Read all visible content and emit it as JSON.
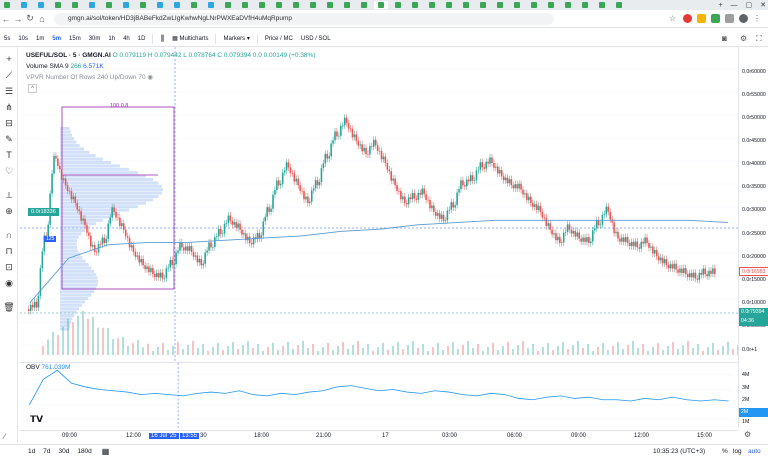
{
  "browser": {
    "url": "gmgn.ai/sol/token/HD3jBABeFkdZwLIgKwhwNgLNrPWXEaDVfH4uMqRpump",
    "tab_colors": [
      "#3aa757",
      "#2ea7e0",
      "#2ea7e0",
      "#3aa757",
      "#3aa757",
      "#2ea7e0",
      "#3aa757",
      "#2ea7e0",
      "#3aa757",
      "#2ea7e0",
      "#2ea7e0",
      "#3aa757",
      "#2ea7e0",
      "#3aa757",
      "#3aa757",
      "#3aa757",
      "#3aa757",
      "#3aa757",
      "#3aa757",
      "#3aa757",
      "#3aa757",
      "#3aa757",
      "#3aa757",
      "#3aa757",
      "#3aa757",
      "#3aa757",
      "#3aa757",
      "#3aa757",
      "#3aa757",
      "#3aa757",
      "#3aa757",
      "#3aa757",
      "#3aa757",
      "#3aa757",
      "#3aa757",
      "#3aa757",
      "#3aa757"
    ],
    "window_controls": [
      "+",
      "—",
      "▢",
      "✕"
    ]
  },
  "toolbar": {
    "intervals": [
      "5s",
      "10s",
      "1m",
      "5m",
      "15m",
      "30m",
      "1h",
      "4h",
      "1D"
    ],
    "active_interval": "5m",
    "multicharts": "Multicharts",
    "markers": "Markers",
    "price_mc": "Price / MC",
    "currency": "USD / SOL"
  },
  "legend": {
    "symbol": "USEFUL/SOL · 5 · GMGN.AI",
    "ohlc": "O 0.079119 H 0.079442 L 0.078764 C 0.079394 0.0 0.00149 (+0.38%)",
    "volume": "Volume SMA 9",
    "volume_val_1": "266",
    "volume_val_2": "6.571K",
    "vpvr": "VPVR Number Of Rows 240 Up/Down 70",
    "obv_label": "OBV",
    "obv_value": "761.039M",
    "box_label": "100 0.8",
    "marker_125": "125",
    "price_label_left": "0.0r18336"
  },
  "price_axis": {
    "ticks": [
      "0.0r60000",
      "0.0r55000",
      "0.0r50000",
      "0.0r45000",
      "0.0r40000",
      "0.0r35000",
      "0.0r30000",
      "0.0r25000",
      "0.0r20000",
      "0.0r15000",
      "0.0r10000",
      "0.0r50000",
      "0.0r+1"
    ],
    "red_label": "0.0r16983",
    "green_label": "0.0r79394",
    "green_countdown": "04:36",
    "obv_ticks": [
      "4M",
      "3M",
      "2M",
      "1M"
    ],
    "obv_label_box": "2M"
  },
  "time_axis": {
    "labels": [
      "09:00",
      "12:00",
      "16 Jul '25",
      "13:55",
      "30",
      "18:00",
      "21:00",
      "17",
      "03:00",
      "06:00",
      "09:00",
      "12:00",
      "15:00"
    ]
  },
  "bottom": {
    "ranges": [
      "1d",
      "7d",
      "30d",
      "180d"
    ],
    "clock": "10:35:23 (UTC+3)",
    "pct": "%",
    "log": "log",
    "auto": "auto"
  },
  "colors": {
    "up": "#26a69a",
    "down": "#ef5350",
    "accent": "#2962ff",
    "ma_line": "#5b9bd5",
    "box": "#9c27b0",
    "volume_profile": "#9bbcf2"
  },
  "chart_data": {
    "type": "candlestick",
    "series": [
      {
        "name": "USEFUL/SOL",
        "values": [
          0.095,
          0.25,
          0.43,
          0.37,
          0.33,
          0.28,
          0.22,
          0.24,
          0.31,
          0.27,
          0.22,
          0.19,
          0.17,
          0.16,
          0.19,
          0.23,
          0.22,
          0.19,
          0.23,
          0.26,
          0.29,
          0.27,
          0.24,
          0.25,
          0.31,
          0.37,
          0.41,
          0.37,
          0.33,
          0.37,
          0.43,
          0.48,
          0.51,
          0.47,
          0.44,
          0.46,
          0.42,
          0.37,
          0.33,
          0.34,
          0.35,
          0.31,
          0.29,
          0.32,
          0.37,
          0.38,
          0.41,
          0.42,
          0.39,
          0.37,
          0.36,
          0.33,
          0.31,
          0.27,
          0.24,
          0.27,
          0.25,
          0.24,
          0.28,
          0.31,
          0.25,
          0.24,
          0.23,
          0.24,
          0.21,
          0.19,
          0.18,
          0.17,
          0.16,
          0.17,
          0.17
        ]
      }
    ],
    "ma_values": [
      0.1,
      0.2,
      0.23,
      0.235,
      0.235,
      0.24,
      0.245,
      0.25,
      0.26,
      0.265,
      0.275,
      0.28,
      0.285,
      0.285,
      0.285,
      0.285,
      0.285,
      0.285,
      0.28
    ],
    "obv_values": [
      1.5,
      3.5,
      4.2,
      3.2,
      2.9,
      2.7,
      2.6,
      2.5,
      2.3,
      2.4,
      2.3,
      2.2,
      2.4,
      2.5,
      2.4,
      2.6,
      2.3,
      2.2,
      2.4,
      2.3,
      2.5,
      2.6,
      2.9,
      3.0,
      2.8,
      2.6,
      2.7,
      2.5,
      2.4,
      2.6,
      2.5,
      2.3,
      2.2,
      2.4,
      2.3,
      2.0,
      1.9,
      2.1,
      2.2,
      2.0,
      2.1,
      1.9,
      1.9,
      1.8,
      2.0,
      1.9,
      2.1,
      1.9,
      1.8,
      1.9,
      1.8
    ],
    "ylabel": "",
    "xlabel": "",
    "grid": true
  }
}
